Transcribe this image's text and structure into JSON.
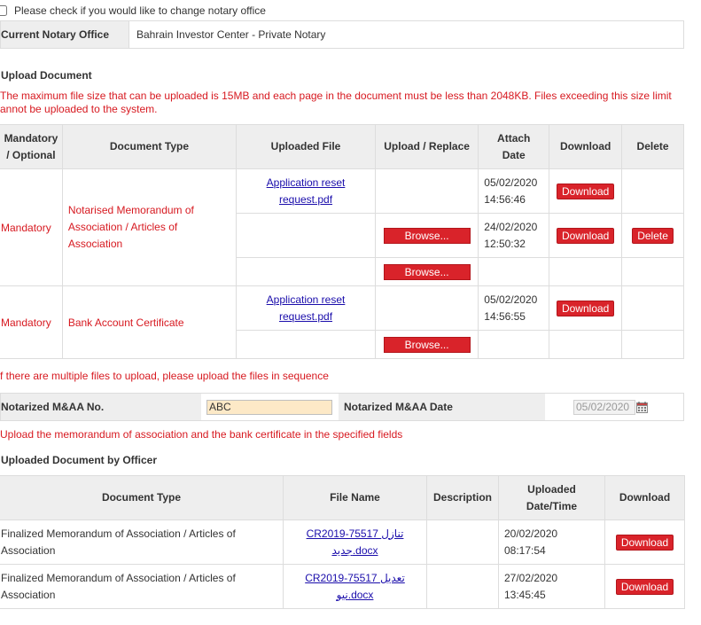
{
  "change_notary": {
    "label": "Please check if you would like to change notary office",
    "checked": false
  },
  "current_notary": {
    "label": "Current Notary Office",
    "value": "Bahrain Investor Center - Private Notary"
  },
  "upload_document": {
    "title": "Upload Document",
    "warning_line1": "The maximum file size that can be uploaded is 15MB and each page in the document must be less than 2048KB. Files exceeding this size limit",
    "warning_line2": "annot be uploaded to the system.",
    "headers": {
      "mandatory_l1": "Mandatory",
      "mandatory_l2": "/ Optional",
      "doc_type": "Document Type",
      "uploaded_file": "Uploaded File",
      "upload_replace": "Upload / Replace",
      "attach_l1": "Attach",
      "attach_l2": "Date",
      "download": "Download",
      "delete": "Delete"
    },
    "groups": [
      {
        "mandatory": "Mandatory",
        "type_lines": [
          "Notarised Memorandum of",
          "Association / Articles of",
          "Association"
        ],
        "rows": [
          {
            "file_l1": "Application reset",
            "file_l2": "request.pdf",
            "browse": "",
            "date": "05/02/2020",
            "time": "14:56:46",
            "download": "Download",
            "delete": ""
          },
          {
            "file_l1": "",
            "file_l2": "",
            "browse": "Browse...",
            "date": "24/02/2020",
            "time": "12:50:32",
            "download": "Download",
            "delete": "Delete"
          },
          {
            "file_l1": "",
            "file_l2": "",
            "browse": "Browse...",
            "date": "",
            "time": "",
            "download": "",
            "delete": ""
          }
        ]
      },
      {
        "mandatory": "Mandatory",
        "type_lines": [
          "Bank Account Certificate"
        ],
        "rows": [
          {
            "file_l1": "Application reset",
            "file_l2": "request.pdf",
            "browse": "",
            "date": "05/02/2020",
            "time": "14:56:55",
            "download": "Download",
            "delete": ""
          },
          {
            "file_l1": "",
            "file_l2": "",
            "browse": "Browse...",
            "date": "",
            "time": "",
            "download": "",
            "delete": ""
          }
        ]
      }
    ],
    "sequence_note": "f there are multiple files to upload, please upload the files in sequence"
  },
  "maa": {
    "no_label": "Notarized M&AA No.",
    "no_value": "ABC",
    "date_label": "Notarized M&AA Date",
    "date_value": "05/02/2020",
    "calendar_icon": "calendar-icon"
  },
  "maa_note": "Upload the memorandum of association and the bank certificate in the specified fields",
  "officer": {
    "title": "Uploaded Document by Officer",
    "headers": {
      "doc_type": "Document Type",
      "file_name": "File Name",
      "description": "Description",
      "uploaded_l1": "Uploaded",
      "uploaded_l2": "Date/Time",
      "download": "Download"
    },
    "rows": [
      {
        "type_l1": "Finalized Memorandum of Association / Articles of",
        "type_l2": "Association",
        "file_l1": "CR2019-75517 تنازل",
        "file_l2": "جديد.docx",
        "description": "",
        "date": "20/02/2020",
        "time": "08:17:54",
        "download": "Download"
      },
      {
        "type_l1": "Finalized Memorandum of Association / Articles of",
        "type_l2": "Association",
        "file_l1": "CR2019-75517 تعديل",
        "file_l2": "نيو.docx",
        "description": "",
        "date": "27/02/2020",
        "time": "13:45:45",
        "download": "Download"
      }
    ]
  },
  "colors": {
    "accent_red": "#d9232a",
    "text_red": "#d71920",
    "header_gray": "#eeeeee",
    "link_blue": "#1a0dab",
    "input_highlight": "#fde9c7"
  }
}
